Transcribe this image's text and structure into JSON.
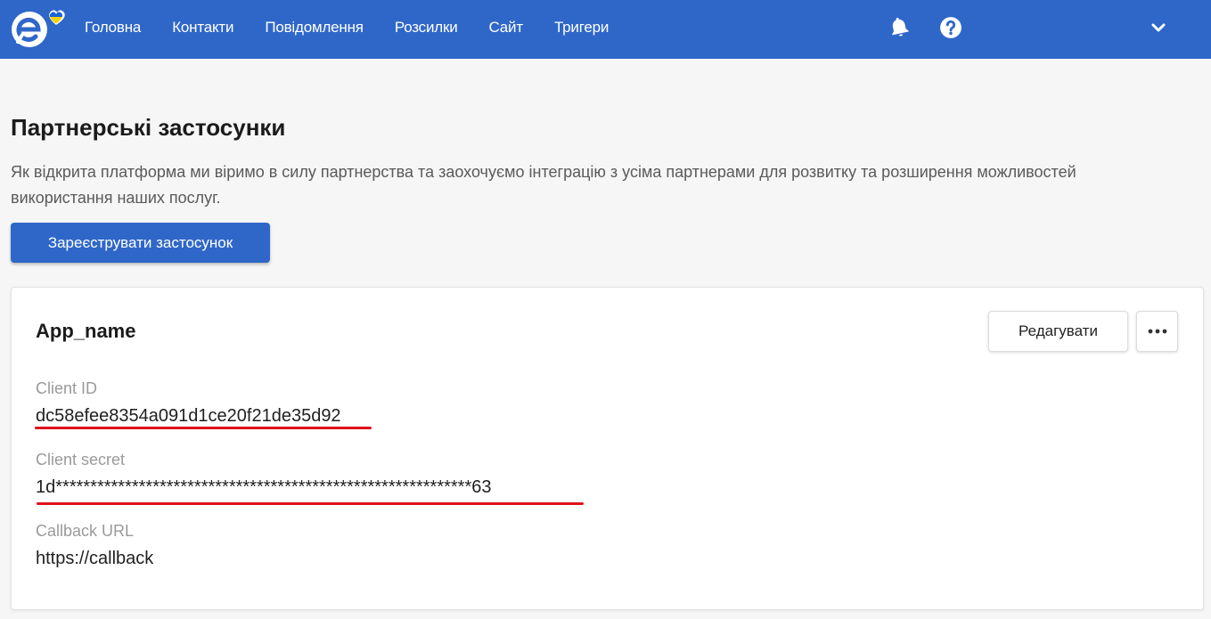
{
  "nav": {
    "items": [
      "Головна",
      "Контакти",
      "Повідомлення",
      "Розсилки",
      "Сайт",
      "Тригери"
    ]
  },
  "page": {
    "title": "Партнерські застосунки",
    "description": "Як відкрита платформа ми віримо в силу партнерства та заохочуємо інтеграцію з усіма партнерами для розвитку та розширення можливостей використання наших послуг.",
    "register_label": "Зареєструвати застосунок"
  },
  "app": {
    "name": "App_name",
    "edit_label": "Редагувати",
    "client_id_label": "Client ID",
    "client_id": "dc58efee8354a091d1ce20f21de35d92",
    "client_secret_label": "Client secret",
    "client_secret": "1d************************************************************63",
    "callback_label": "Callback URL",
    "callback_url": "https://callback"
  },
  "colors": {
    "brand": "#2f67c9",
    "annotation_underline": "#e0121b",
    "background": "#f6f6f6",
    "logo_heart_blue": "#1a63d6",
    "logo_heart_yellow": "#f5d20c"
  },
  "icons": [
    "brand-logo-icon",
    "bell-icon",
    "help-icon",
    "chevron-down-icon",
    "more-dots-icon"
  ]
}
